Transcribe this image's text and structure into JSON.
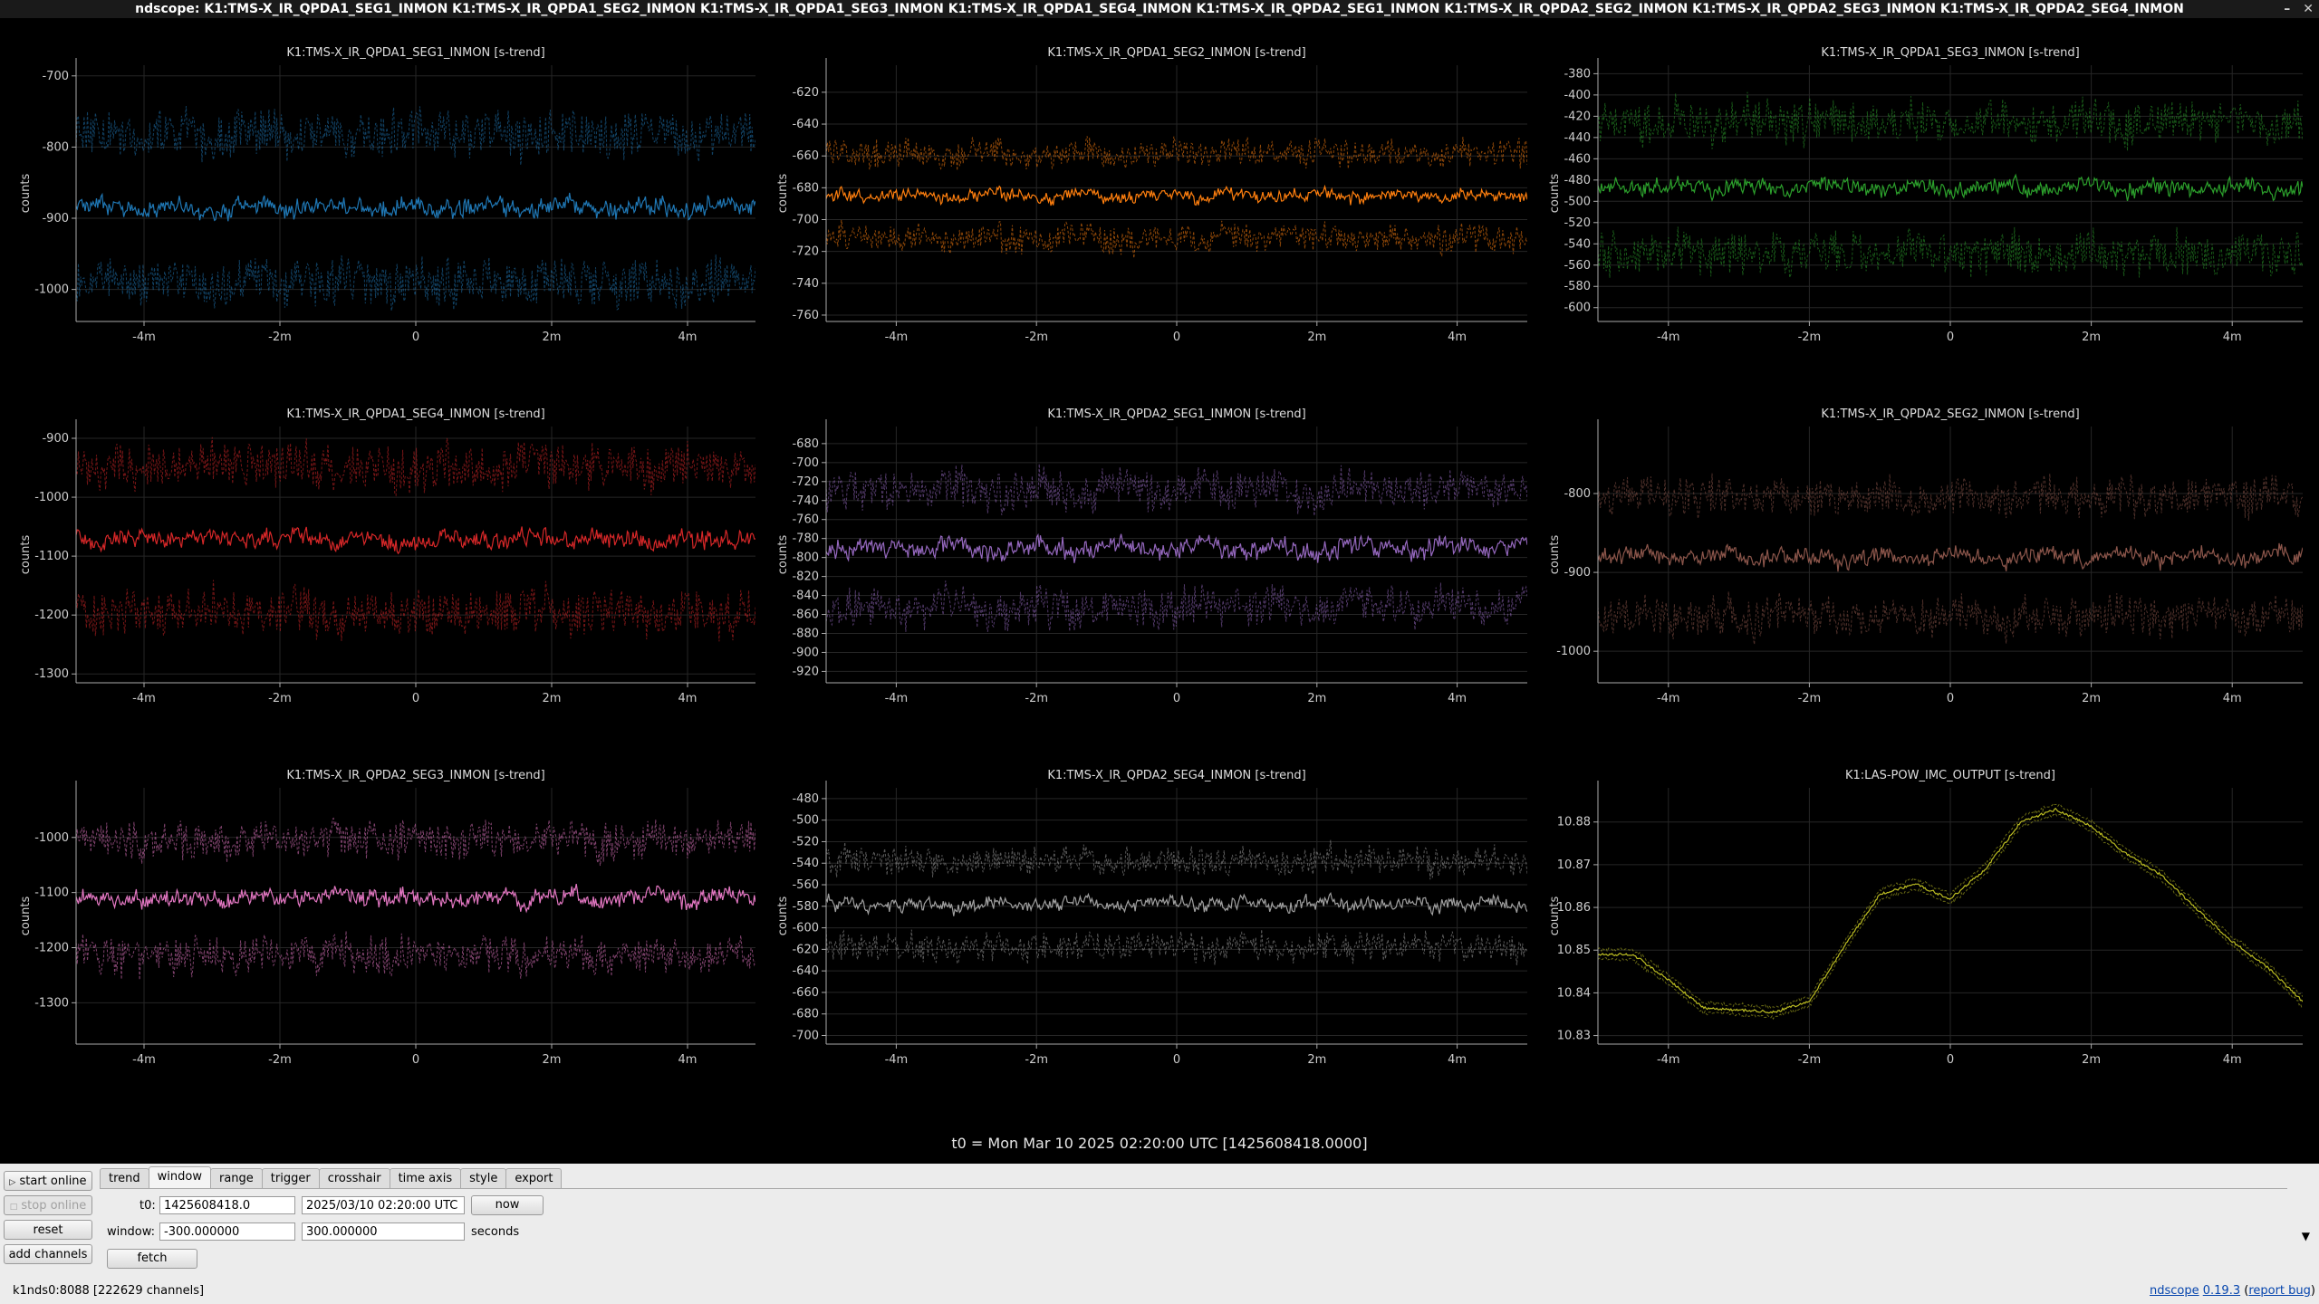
{
  "window": {
    "title": "ndscope: K1:TMS-X_IR_QPDA1_SEG1_INMON K1:TMS-X_IR_QPDA1_SEG2_INMON K1:TMS-X_IR_QPDA1_SEG3_INMON K1:TMS-X_IR_QPDA1_SEG4_INMON K1:TMS-X_IR_QPDA2_SEG1_INMON K1:TMS-X_IR_QPDA2_SEG2_INMON K1:TMS-X_IR_QPDA2_SEG3_INMON K1:TMS-X_IR_QPDA2_SEG4_INMON",
    "controls": [
      "–",
      "✕"
    ]
  },
  "x_ticks": [
    "-4m",
    "-2m",
    "0",
    "2m",
    "4m"
  ],
  "y_label": "counts",
  "t0_text": "t0 = Mon Mar 10 2025 02:20:00 UTC [1425608418.0000]",
  "chart_data": [
    {
      "type": "line",
      "title": "K1:TMS-X_IR_QPDA1_SEG1_INMON [s-trend]",
      "color": "#1f77b4",
      "ylabel": "counts",
      "xlim": [
        -300,
        300
      ],
      "ylim": [
        -1045,
        -685
      ],
      "y_ticks": [
        -700,
        -800,
        -900,
        -1000
      ],
      "mean": -885,
      "band": 110,
      "noise": 16
    },
    {
      "type": "line",
      "title": "K1:TMS-X_IR_QPDA1_SEG2_INMON [s-trend]",
      "color": "#ff7f0e",
      "ylabel": "counts",
      "xlim": [
        -300,
        300
      ],
      "ylim": [
        -764,
        -603
      ],
      "y_ticks": [
        -620,
        -640,
        -660,
        -680,
        -700,
        -720,
        -740,
        -760
      ],
      "mean": -685,
      "band": 28,
      "noise": 5
    },
    {
      "type": "line",
      "title": "K1:TMS-X_IR_QPDA1_SEG3_INMON [s-trend]",
      "color": "#2ca02c",
      "ylabel": "counts",
      "xlim": [
        -300,
        300
      ],
      "ylim": [
        -613,
        -372
      ],
      "y_ticks": [
        -380,
        -400,
        -420,
        -440,
        -460,
        -480,
        -500,
        -520,
        -540,
        -560,
        -580,
        -600
      ],
      "mean": -487,
      "band": 65,
      "noise": 10
    },
    {
      "type": "line",
      "title": "K1:TMS-X_IR_QPDA1_SEG4_INMON [s-trend]",
      "color": "#d62728",
      "ylabel": "counts",
      "xlim": [
        -300,
        300
      ],
      "ylim": [
        -1315,
        -880
      ],
      "y_ticks": [
        -900,
        -1000,
        -1100,
        -1200,
        -1300
      ],
      "mean": -1070,
      "band": 130,
      "noise": 20
    },
    {
      "type": "line",
      "title": "K1:TMS-X_IR_QPDA2_SEG1_INMON [s-trend]",
      "color": "#9467bd",
      "ylabel": "counts",
      "xlim": [
        -300,
        300
      ],
      "ylim": [
        -932,
        -662
      ],
      "y_ticks": [
        -680,
        -700,
        -720,
        -740,
        -760,
        -780,
        -800,
        -820,
        -840,
        -860,
        -880,
        -900,
        -920
      ],
      "mean": -790,
      "band": 65,
      "noise": 13
    },
    {
      "type": "line",
      "title": "K1:TMS-X_IR_QPDA2_SEG2_INMON [s-trend]",
      "color": "#8c564b",
      "ylabel": "counts",
      "xlim": [
        -300,
        300
      ],
      "ylim": [
        -1040,
        -715
      ],
      "y_ticks": [
        -800,
        -900,
        -1000
      ],
      "mean": -880,
      "band": 80,
      "noise": 14
    },
    {
      "type": "line",
      "title": "K1:TMS-X_IR_QPDA2_SEG3_INMON [s-trend]",
      "color": "#e377c2",
      "ylabel": "counts",
      "xlim": [
        -300,
        300
      ],
      "ylim": [
        -1375,
        -910
      ],
      "y_ticks": [
        -1000,
        -1100,
        -1200,
        -1300
      ],
      "mean": -1110,
      "band": 110,
      "noise": 20
    },
    {
      "type": "line",
      "title": "K1:TMS-X_IR_QPDA2_SEG4_INMON [s-trend]",
      "color": "#a0a0a0",
      "ylabel": "counts",
      "xlim": [
        -300,
        300
      ],
      "ylim": [
        -708,
        -470
      ],
      "y_ticks": [
        -480,
        -500,
        -520,
        -540,
        -560,
        -580,
        -600,
        -620,
        -640,
        -660,
        -680,
        -700
      ],
      "mean": -578,
      "band": 42,
      "noise": 8
    },
    {
      "type": "line",
      "title": "K1:LAS-POW_IMC_OUTPUT [s-trend]",
      "color": "#bcbd22",
      "ylabel": "counts",
      "xlim": [
        -300,
        300
      ],
      "ylim": [
        10.828,
        10.888
      ],
      "y_ticks": [
        10.83,
        10.84,
        10.85,
        10.86,
        10.87,
        10.88
      ],
      "x": [
        -300,
        -270,
        -240,
        -210,
        -180,
        -150,
        -120,
        -90,
        -60,
        -30,
        0,
        30,
        60,
        90,
        120,
        150,
        180,
        210,
        240,
        270,
        300
      ],
      "y": [
        10.849,
        10.849,
        10.843,
        10.8365,
        10.836,
        10.8355,
        10.838,
        10.851,
        10.863,
        10.8655,
        10.862,
        10.869,
        10.88,
        10.883,
        10.879,
        10.8725,
        10.8675,
        10.8595,
        10.852,
        10.846,
        10.838
      ],
      "band": 0.0012,
      "noise": 0.0006
    }
  ],
  "tabs": [
    "trend",
    "window",
    "range",
    "trigger",
    "crosshair",
    "time axis",
    "style",
    "export"
  ],
  "active_tab": "window",
  "buttons": {
    "start_online": "start online",
    "stop_online": "stop online",
    "reset": "reset",
    "add_channels": "add channels",
    "now": "now",
    "fetch": "fetch"
  },
  "window_tab": {
    "t0_label": "t0:",
    "t0_gps": "1425608418.0",
    "t0_utc": "2025/03/10 02:20:00 UTC",
    "window_label": "window:",
    "window_start": "-300.000000",
    "window_end": "300.000000",
    "window_unit": "seconds"
  },
  "status": "k1nds0:8088  [222629 channels]",
  "version": {
    "name": "ndscope",
    "number": "0.19.3",
    "report": "report bug"
  },
  "colors": {
    "background": "#000000",
    "grid": "#2a2a2a",
    "axis": "#aaaaaa",
    "panel": "#ececec"
  }
}
